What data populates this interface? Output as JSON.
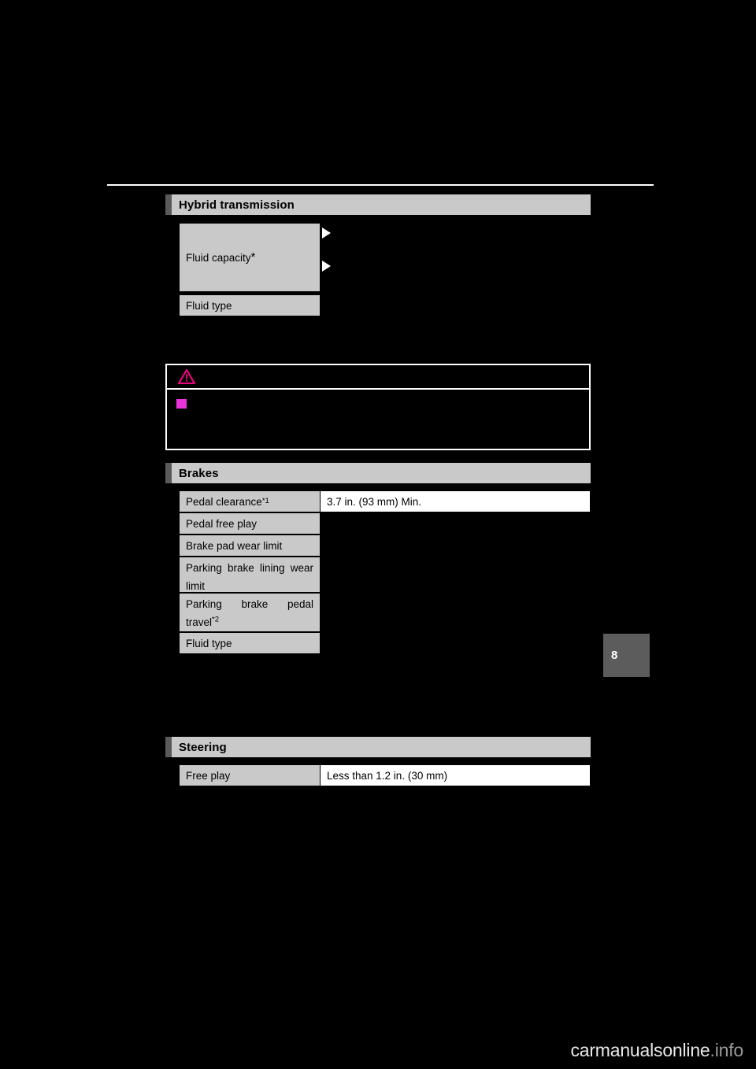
{
  "page": {
    "number": "8",
    "watermark_main": "carmanualsonline",
    "watermark_suffix": ".info"
  },
  "sections": [
    {
      "id": "hybrid-transmission",
      "title": "Hybrid transmission",
      "rows": [
        {
          "label": "Fluid capacity",
          "label_sup": "*",
          "value": ""
        },
        {
          "label": "Fluid type",
          "label_sup": "",
          "value": ""
        }
      ]
    },
    {
      "id": "brakes",
      "title": "Brakes",
      "rows": [
        {
          "label": "Pedal clearance",
          "label_sup": "*1",
          "value": "3.7 in. (93 mm) Min."
        },
        {
          "label": "Pedal free play",
          "label_sup": "",
          "value": ""
        },
        {
          "label": "Brake pad wear limit",
          "label_sup": "",
          "value": ""
        },
        {
          "label": "Parking brake lining wear limit",
          "label_sup": "",
          "value": ""
        },
        {
          "label": "Parking brake pedal travel",
          "label_sup": "*2",
          "value": ""
        },
        {
          "label": "Fluid type",
          "label_sup": "",
          "value": ""
        }
      ]
    },
    {
      "id": "steering",
      "title": "Steering",
      "rows": [
        {
          "label": "Free play",
          "label_sup": "",
          "value": "Less than 1.2 in. (30 mm)"
        }
      ]
    }
  ],
  "caution": {
    "icon": "warning-triangle-icon",
    "heading": "",
    "bullet_icon": "magenta-square-bullet",
    "body": ""
  },
  "colors": {
    "header_bar": "#c9c9c9",
    "header_tab": "#5a5a5a",
    "page_background": "#000000",
    "table_value_bg": "#ffffff",
    "bullet_magenta": "#e833d8",
    "warning_triangle": "#e8007d"
  }
}
